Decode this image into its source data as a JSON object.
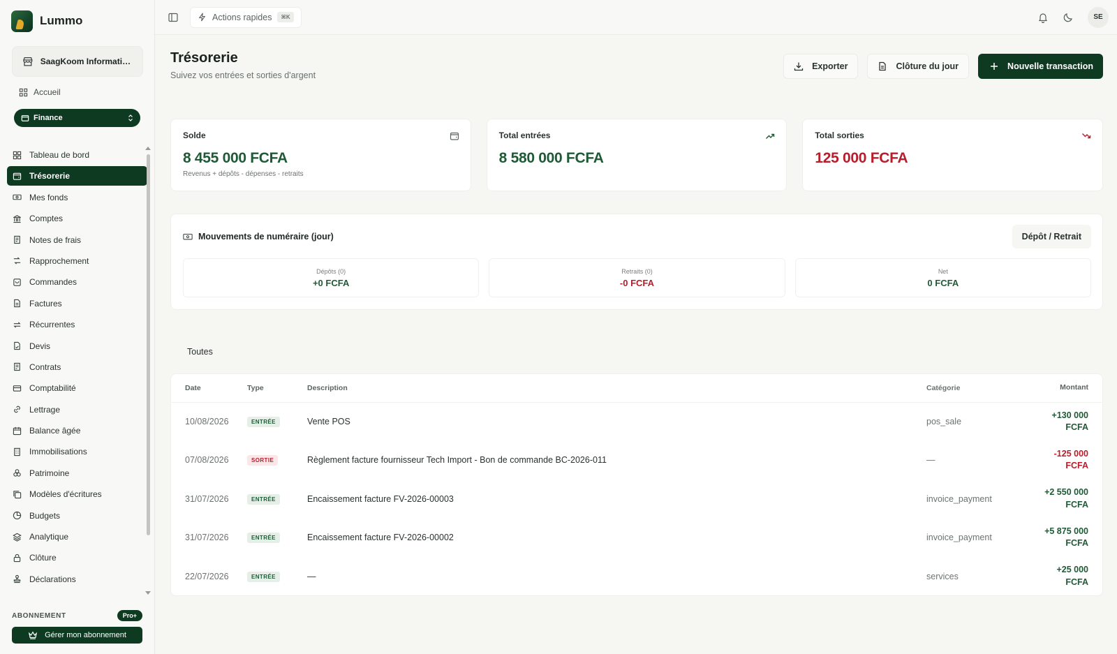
{
  "brand": {
    "name": "Lummo"
  },
  "org": {
    "name": "SaagKoom Informatiq..."
  },
  "home": {
    "label": "Accueil"
  },
  "module": {
    "label": "Finance"
  },
  "nav": [
    {
      "label": "Tableau de bord",
      "icon": "dashboard-icon"
    },
    {
      "label": "Trésorerie",
      "icon": "wallet-icon",
      "active": true
    },
    {
      "label": "Mes fonds",
      "icon": "funds-icon"
    },
    {
      "label": "Comptes",
      "icon": "bank-icon"
    },
    {
      "label": "Notes de frais",
      "icon": "receipt-icon"
    },
    {
      "label": "Rapprochement",
      "icon": "reconcile-icon"
    },
    {
      "label": "Commandes",
      "icon": "cart-icon"
    },
    {
      "label": "Factures",
      "icon": "invoice-icon"
    },
    {
      "label": "Récurrentes",
      "icon": "repeat-icon"
    },
    {
      "label": "Devis",
      "icon": "quote-icon"
    },
    {
      "label": "Contrats",
      "icon": "contract-icon"
    },
    {
      "label": "Comptabilité",
      "icon": "accounting-icon"
    },
    {
      "label": "Lettrage",
      "icon": "link-icon"
    },
    {
      "label": "Balance âgée",
      "icon": "calendar-icon"
    },
    {
      "label": "Immobilisations",
      "icon": "building-icon"
    },
    {
      "label": "Patrimoine",
      "icon": "assets-icon"
    },
    {
      "label": "Modèles d'écritures",
      "icon": "copy-icon"
    },
    {
      "label": "Budgets",
      "icon": "pie-icon"
    },
    {
      "label": "Analytique",
      "icon": "layers-icon"
    },
    {
      "label": "Clôture",
      "icon": "lock-icon"
    },
    {
      "label": "Déclarations",
      "icon": "stamp-icon"
    }
  ],
  "subscription": {
    "label": "ABONNEMENT",
    "badge": "Pro+",
    "manage_label": "Gérer mon abonnement"
  },
  "topbar": {
    "quick_actions": "Actions rapides",
    "shortcut": "⌘K",
    "avatar": "SE"
  },
  "page": {
    "title": "Trésorerie",
    "subtitle": "Suivez vos entrées et sorties d'argent"
  },
  "actions": {
    "export": "Exporter",
    "close_day": "Clôture du jour",
    "new_tx": "Nouvelle transaction"
  },
  "cards": {
    "balance": {
      "label": "Solde",
      "value": "8 455 000 FCFA",
      "note": "Revenus + dépôts - dépenses - retraits"
    },
    "income": {
      "label": "Total entrées",
      "value": "8 580 000 FCFA"
    },
    "expense": {
      "label": "Total sorties",
      "value": "125 000 FCFA"
    }
  },
  "cash": {
    "title": "Mouvements de numéraire (jour)",
    "button": "Dépôt / Retrait",
    "deposits": {
      "label": "Dépôts (0)",
      "value": "+0 FCFA"
    },
    "withdrawals": {
      "label": "Retraits (0)",
      "value": "-0 FCFA"
    },
    "net": {
      "label": "Net",
      "value": "0 FCFA"
    }
  },
  "filter": {
    "all": "Toutes"
  },
  "table": {
    "headers": {
      "date": "Date",
      "type": "Type",
      "description": "Description",
      "category": "Catégorie",
      "amount": "Montant"
    },
    "rows": [
      {
        "date": "10/08/2026",
        "type": "ENTRÉE",
        "kind": "in",
        "description": "Vente POS",
        "category": "pos_sale",
        "amount": "+130 000",
        "currency": "FCFA"
      },
      {
        "date": "07/08/2026",
        "type": "SORTIE",
        "kind": "out",
        "description": "Règlement facture fournisseur Tech Import - Bon de commande BC-2026-011",
        "category": "—",
        "amount": "-125 000",
        "currency": "FCFA"
      },
      {
        "date": "31/07/2026",
        "type": "ENTRÉE",
        "kind": "in",
        "description": "Encaissement facture FV-2026-00003",
        "category": "invoice_payment",
        "amount": "+2 550 000",
        "currency": "FCFA"
      },
      {
        "date": "31/07/2026",
        "type": "ENTRÉE",
        "kind": "in",
        "description": "Encaissement facture FV-2026-00002",
        "category": "invoice_payment",
        "amount": "+5 875 000",
        "currency": "FCFA"
      },
      {
        "date": "22/07/2026",
        "type": "ENTRÉE",
        "kind": "in",
        "description": "—",
        "category": "services",
        "amount": "+25 000",
        "currency": "FCFA"
      }
    ]
  },
  "colors": {
    "brand": "#0f3a22",
    "positive": "#1e5a36",
    "negative": "#b91c2a"
  }
}
